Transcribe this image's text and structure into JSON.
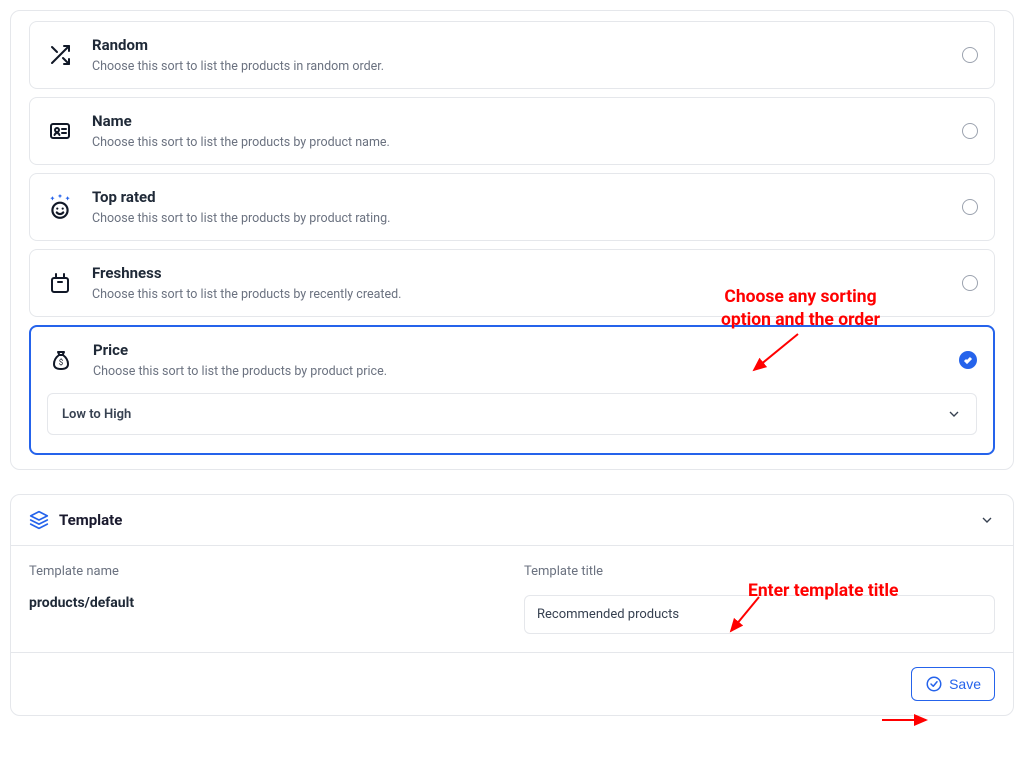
{
  "sort": {
    "random": {
      "title": "Random",
      "desc": "Choose this sort to list the products in random order."
    },
    "name": {
      "title": "Name",
      "desc": "Choose this sort to list the products by product name."
    },
    "top": {
      "title": "Top rated",
      "desc": "Choose this sort to list the products by product rating."
    },
    "fresh": {
      "title": "Freshness",
      "desc": "Choose this sort to list the products by recently created."
    },
    "price": {
      "title": "Price",
      "desc": "Choose this sort to list the products by product price."
    }
  },
  "order": {
    "selected": "Low to High"
  },
  "template": {
    "heading": "Template",
    "name_label": "Template name",
    "name_value": "products/default",
    "title_label": "Template title",
    "title_value": "Recommended products",
    "save": "Save"
  },
  "annotation": {
    "sort": "Choose any sorting\noption and the order",
    "title": "Enter template title"
  },
  "colors": {
    "accent": "#2563eb",
    "annotation": "#ff0000"
  }
}
